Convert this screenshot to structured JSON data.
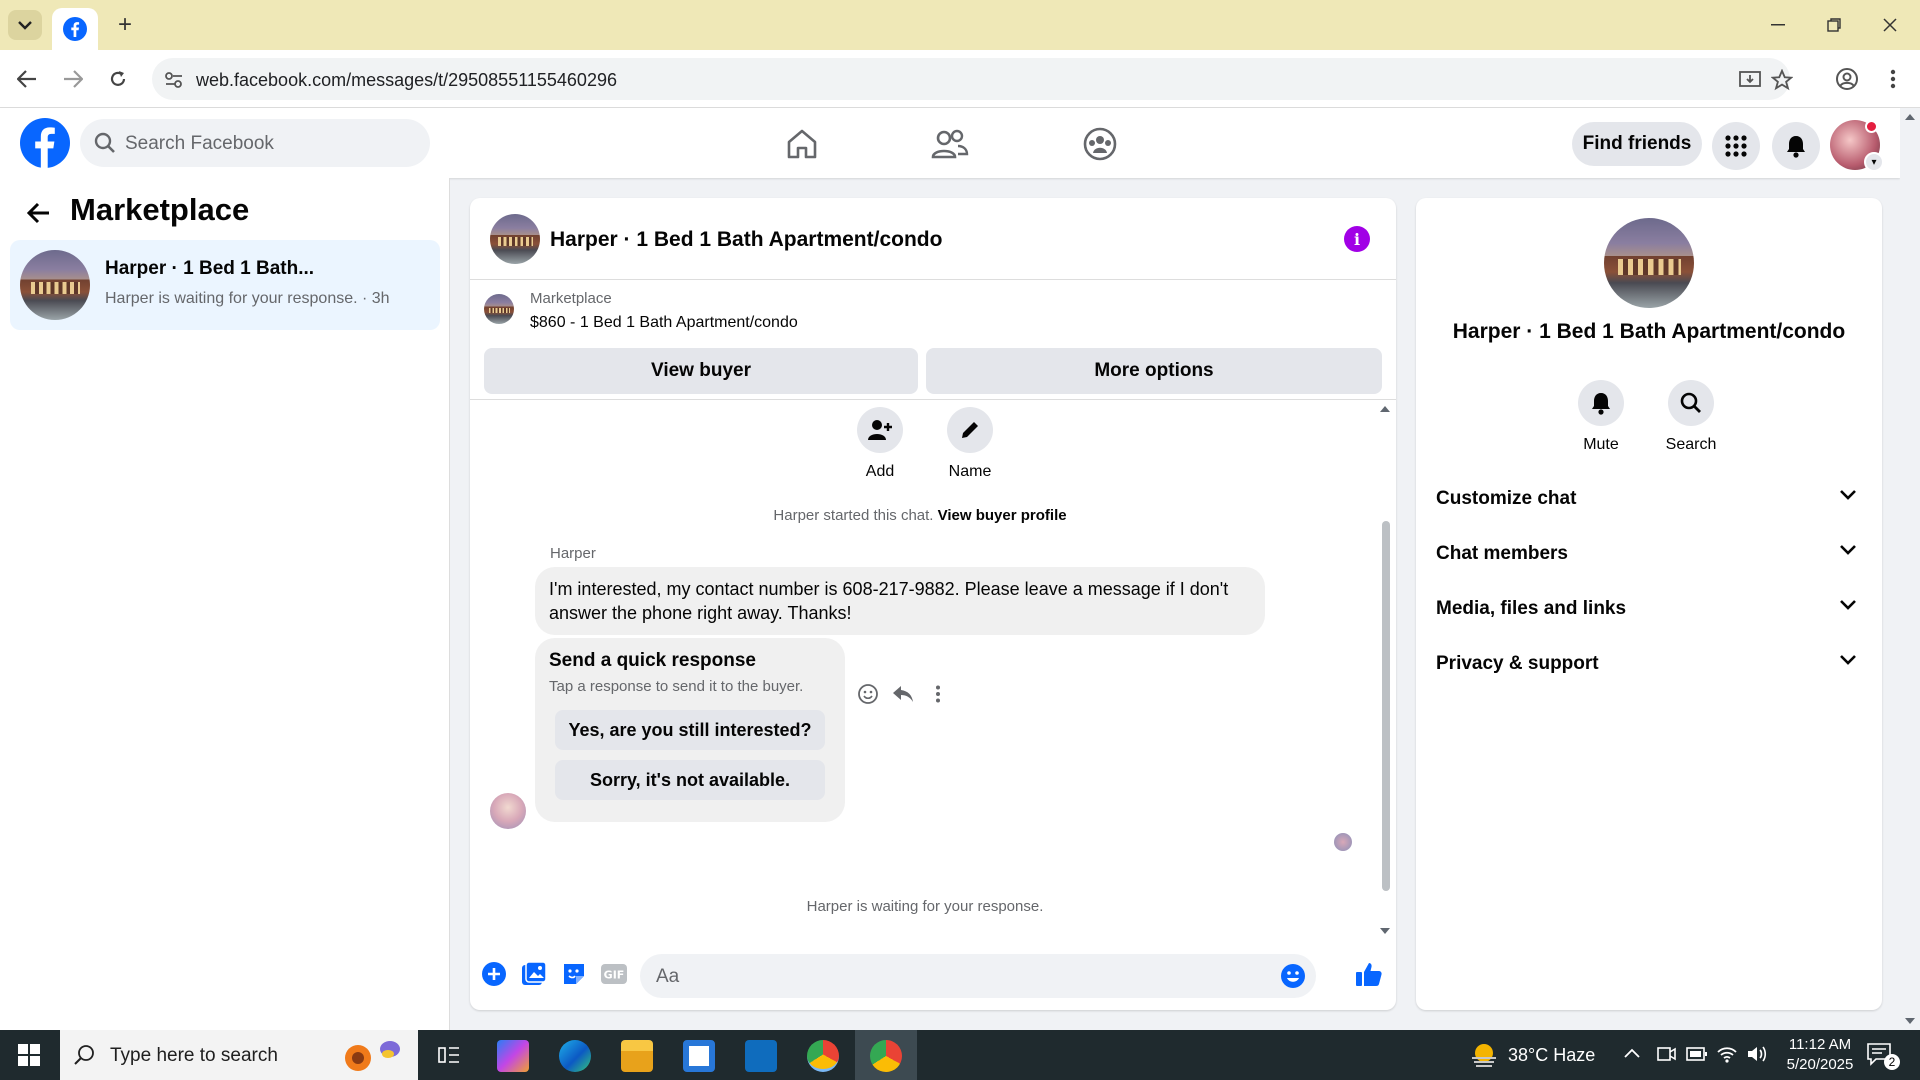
{
  "browser": {
    "tab_icon": "facebook-icon",
    "url": "web.facebook.com/messages/t/29508551155460296"
  },
  "fb_header": {
    "search_placeholder": "Search Facebook",
    "find_friends_label": "Find friends",
    "nav_icons": [
      "home-icon",
      "friends-icon",
      "groups-icon"
    ],
    "accent_color": "#0866ff"
  },
  "sidebar": {
    "title": "Marketplace",
    "conversation": {
      "name": "Harper · 1 Bed 1 Bath...",
      "preview": "Harper is waiting for your response. · 3h"
    }
  },
  "chat": {
    "title": "Harper · 1 Bed 1 Bath Apartment/condo",
    "marketplace_label": "Marketplace",
    "listing": "$860 - 1 Bed 1 Bath Apartment/condo",
    "view_buyer_label": "View buyer",
    "more_options_label": "More options",
    "tools": {
      "add_label": "Add",
      "name_label": "Name"
    },
    "started_text": "Harper started this chat.",
    "view_profile_link": "View buyer profile",
    "sender_name": "Harper",
    "message": "I'm interested, my contact number is 608-217-9882. Please leave a message if I don't answer the phone right away. Thanks!",
    "quick_response": {
      "heading": "Send a quick response",
      "subtext": "Tap a response to send it to the buyer.",
      "options": [
        "Yes, are you still interested?",
        "Sorry, it's not available."
      ]
    },
    "waiting_text": "Harper is waiting for your response.",
    "composer_placeholder": "Aa"
  },
  "info_panel": {
    "name": "Harper · 1 Bed 1 Bath Apartment/condo",
    "mute_label": "Mute",
    "search_label": "Search",
    "sections": [
      "Customize chat",
      "Chat members",
      "Media, files and links",
      "Privacy & support"
    ]
  },
  "taskbar": {
    "search_placeholder": "Type here to search",
    "weather": "38°C  Haze",
    "time": "11:12 AM",
    "date": "5/20/2025",
    "notification_count": "2"
  }
}
